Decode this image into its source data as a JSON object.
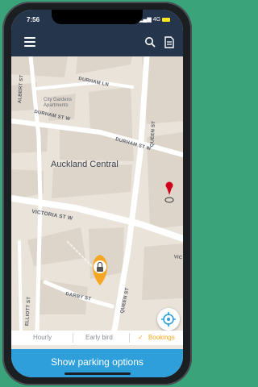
{
  "status": {
    "time": "7:56",
    "signal": "4G"
  },
  "appbar": {
    "menu_icon": "menu-icon",
    "search_icon": "search-icon",
    "doc_icon": "document-icon"
  },
  "map": {
    "area_label": "Auckland Central",
    "poi_line1": "City Gardens",
    "poi_line2": "Apartments",
    "streets": {
      "durham_ln": "DURHAM LN",
      "durham_st_w": "DURHAM ST W",
      "durham_st_e": "DURHAM ST W",
      "victoria_st_w": "VICTORIA ST W",
      "queen_st_upper": "QUEEN ST",
      "queen_st_lower": "QUEEN ST",
      "albert_st": "ALBERT ST",
      "darby_st": "DARBY ST",
      "elliott_st": "ELLIOTT ST",
      "vic_right": "VIC"
    },
    "marker_red": "map-pin",
    "marker_orange": "parking-lock-pin"
  },
  "tabs": {
    "hourly": "Hourly",
    "early_bird": "Early bird",
    "bookings": "Bookings",
    "active": "bookings",
    "check": "✓"
  },
  "cta": {
    "label": "Show parking options"
  },
  "colors": {
    "appbar": "#24354c",
    "accent": "#f5a623",
    "cta": "#2e9fdb"
  }
}
